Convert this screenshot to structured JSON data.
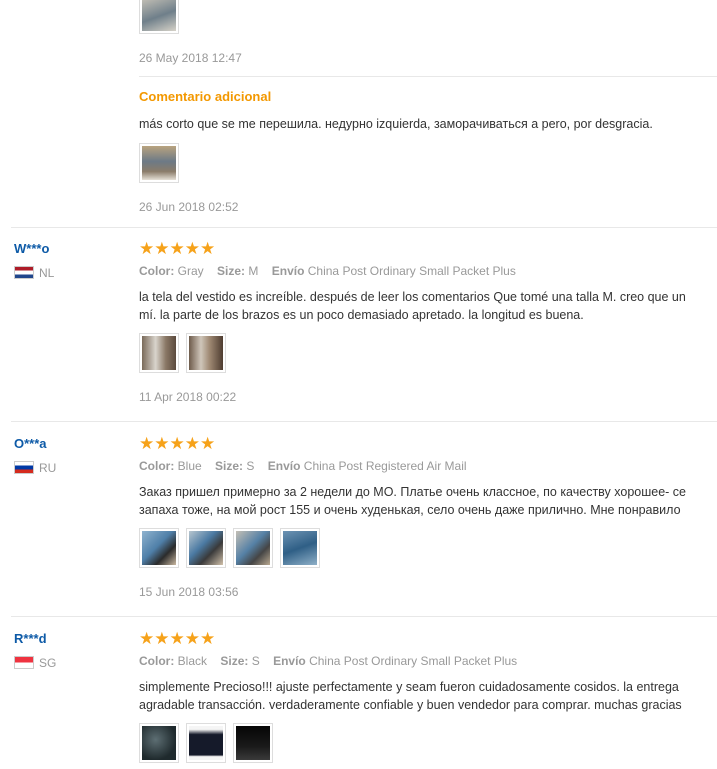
{
  "top": {
    "date": "26 May 2018 12:47",
    "additional_label": "Comentario adicional",
    "additional_text": "más corto que se me перешила. недурно izquierda, заморачиваться a pero, por desgracia.",
    "additional_date": "26 Jun 2018 02:52"
  },
  "labels": {
    "color": "Color:",
    "size": "Size:",
    "ship": "Envío"
  },
  "reviews": [
    {
      "name": "W***o",
      "country": "NL",
      "stars": "★★★★★",
      "color": "Gray",
      "size": "M",
      "ship": "China Post Ordinary Small Packet Plus",
      "line1": "la tela del vestido es increíble. después de leer los comentarios Que tomé una talla M. creo que un",
      "line2": "mí. la parte de los brazos es un poco demasiado apretado. la longitud es buena.",
      "date": "11 Apr 2018 00:22"
    },
    {
      "name": "O***a",
      "country": "RU",
      "stars": "★★★★★",
      "color": "Blue",
      "size": "S",
      "ship": "China Post Registered Air Mail",
      "line1": "Заказ пришел примерно за 2 недели до МО. Платье очень классное, по качеству хорошее- се",
      "line2": "запаха тоже, на мой рост 155 и очень худенькая, село очень даже прилично. Мне понравило",
      "date": "15 Jun 2018 03:56"
    },
    {
      "name": "R***d",
      "country": "SG",
      "stars": "★★★★★",
      "color": "Black",
      "size": "S",
      "ship": "China Post Ordinary Small Packet Plus",
      "line1": "simplemente Precioso!!! ajuste perfectamente y seam fueron cuidadosamente cosidos. la entrega",
      "line2": "agradable transacción. verdaderamente confiable y buen vendedor para comprar. muchas gracias"
    }
  ]
}
